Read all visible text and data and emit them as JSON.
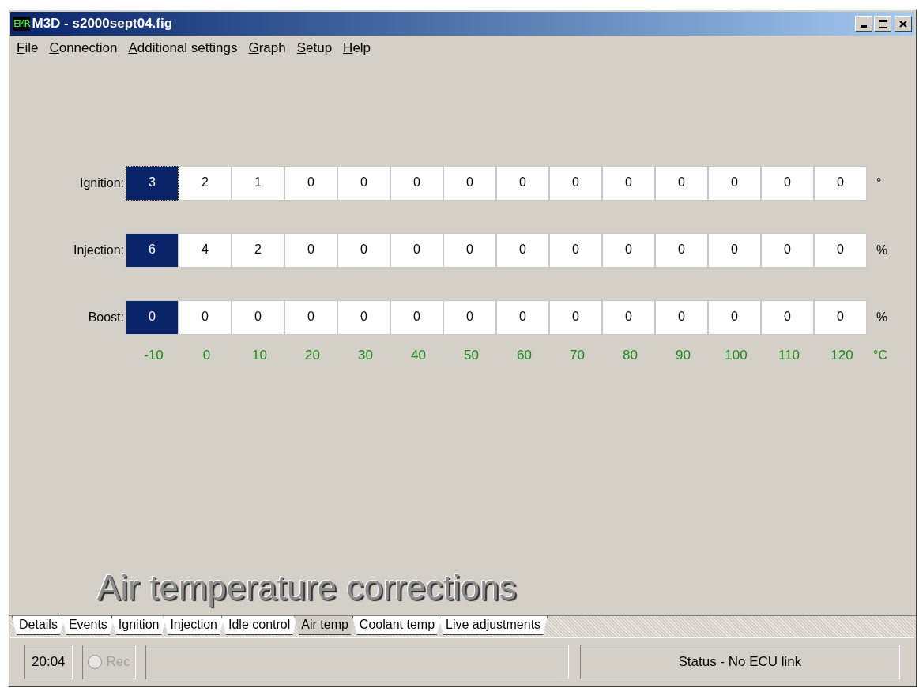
{
  "window": {
    "logo": "EMR",
    "title": "M3D - s2000sept04.fig"
  },
  "menu": [
    "File",
    "Connection",
    "Additional settings",
    "Graph",
    "Setup",
    "Help"
  ],
  "rows": [
    {
      "label": "Ignition:",
      "unit": "°",
      "cells": [
        {
          "value": "3",
          "selected": true,
          "focused": true
        },
        {
          "value": "2",
          "selected": false,
          "focused": false
        },
        {
          "value": "1",
          "selected": false,
          "focused": false
        },
        {
          "value": "0",
          "selected": false,
          "focused": false
        },
        {
          "value": "0",
          "selected": false,
          "focused": false
        },
        {
          "value": "0",
          "selected": false,
          "focused": false
        },
        {
          "value": "0",
          "selected": false,
          "focused": false
        },
        {
          "value": "0",
          "selected": false,
          "focused": false
        },
        {
          "value": "0",
          "selected": false,
          "focused": false
        },
        {
          "value": "0",
          "selected": false,
          "focused": false
        },
        {
          "value": "0",
          "selected": false,
          "focused": false
        },
        {
          "value": "0",
          "selected": false,
          "focused": false
        },
        {
          "value": "0",
          "selected": false,
          "focused": false
        },
        {
          "value": "0",
          "selected": false,
          "focused": false
        }
      ]
    },
    {
      "label": "Injection:",
      "unit": "%",
      "cells": [
        {
          "value": "6",
          "selected": true,
          "focused": false
        },
        {
          "value": "4",
          "selected": false,
          "focused": false
        },
        {
          "value": "2",
          "selected": false,
          "focused": false
        },
        {
          "value": "0",
          "selected": false,
          "focused": false
        },
        {
          "value": "0",
          "selected": false,
          "focused": false
        },
        {
          "value": "0",
          "selected": false,
          "focused": false
        },
        {
          "value": "0",
          "selected": false,
          "focused": false
        },
        {
          "value": "0",
          "selected": false,
          "focused": false
        },
        {
          "value": "0",
          "selected": false,
          "focused": false
        },
        {
          "value": "0",
          "selected": false,
          "focused": false
        },
        {
          "value": "0",
          "selected": false,
          "focused": false
        },
        {
          "value": "0",
          "selected": false,
          "focused": false
        },
        {
          "value": "0",
          "selected": false,
          "focused": false
        },
        {
          "value": "0",
          "selected": false,
          "focused": false
        }
      ]
    },
    {
      "label": "Boost:",
      "unit": "%",
      "cells": [
        {
          "value": "0",
          "selected": true,
          "focused": false
        },
        {
          "value": "0",
          "selected": false,
          "focused": false
        },
        {
          "value": "0",
          "selected": false,
          "focused": false
        },
        {
          "value": "0",
          "selected": false,
          "focused": false
        },
        {
          "value": "0",
          "selected": false,
          "focused": false
        },
        {
          "value": "0",
          "selected": false,
          "focused": false
        },
        {
          "value": "0",
          "selected": false,
          "focused": false
        },
        {
          "value": "0",
          "selected": false,
          "focused": false
        },
        {
          "value": "0",
          "selected": false,
          "focused": false
        },
        {
          "value": "0",
          "selected": false,
          "focused": false
        },
        {
          "value": "0",
          "selected": false,
          "focused": false
        },
        {
          "value": "0",
          "selected": false,
          "focused": false
        },
        {
          "value": "0",
          "selected": false,
          "focused": false
        },
        {
          "value": "0",
          "selected": false,
          "focused": false
        }
      ]
    }
  ],
  "axis": {
    "labels": [
      "-10",
      "0",
      "10",
      "20",
      "30",
      "40",
      "50",
      "60",
      "70",
      "80",
      "90",
      "100",
      "110",
      "120"
    ],
    "unit": "°C"
  },
  "heading": "Air temperature corrections",
  "tabs": [
    {
      "label": "Details",
      "selected": false
    },
    {
      "label": "Events",
      "selected": false
    },
    {
      "label": "Ignition",
      "selected": false
    },
    {
      "label": "Injection",
      "selected": false
    },
    {
      "label": "Idle control",
      "selected": false
    },
    {
      "label": "Air temp",
      "selected": true
    },
    {
      "label": "Coolant temp",
      "selected": false
    },
    {
      "label": "Live adjustments",
      "selected": false
    }
  ],
  "status_bar": {
    "time": "20:04",
    "record": {
      "label": "Rec",
      "disabled": true
    },
    "status": "Status - No ECU link"
  }
}
